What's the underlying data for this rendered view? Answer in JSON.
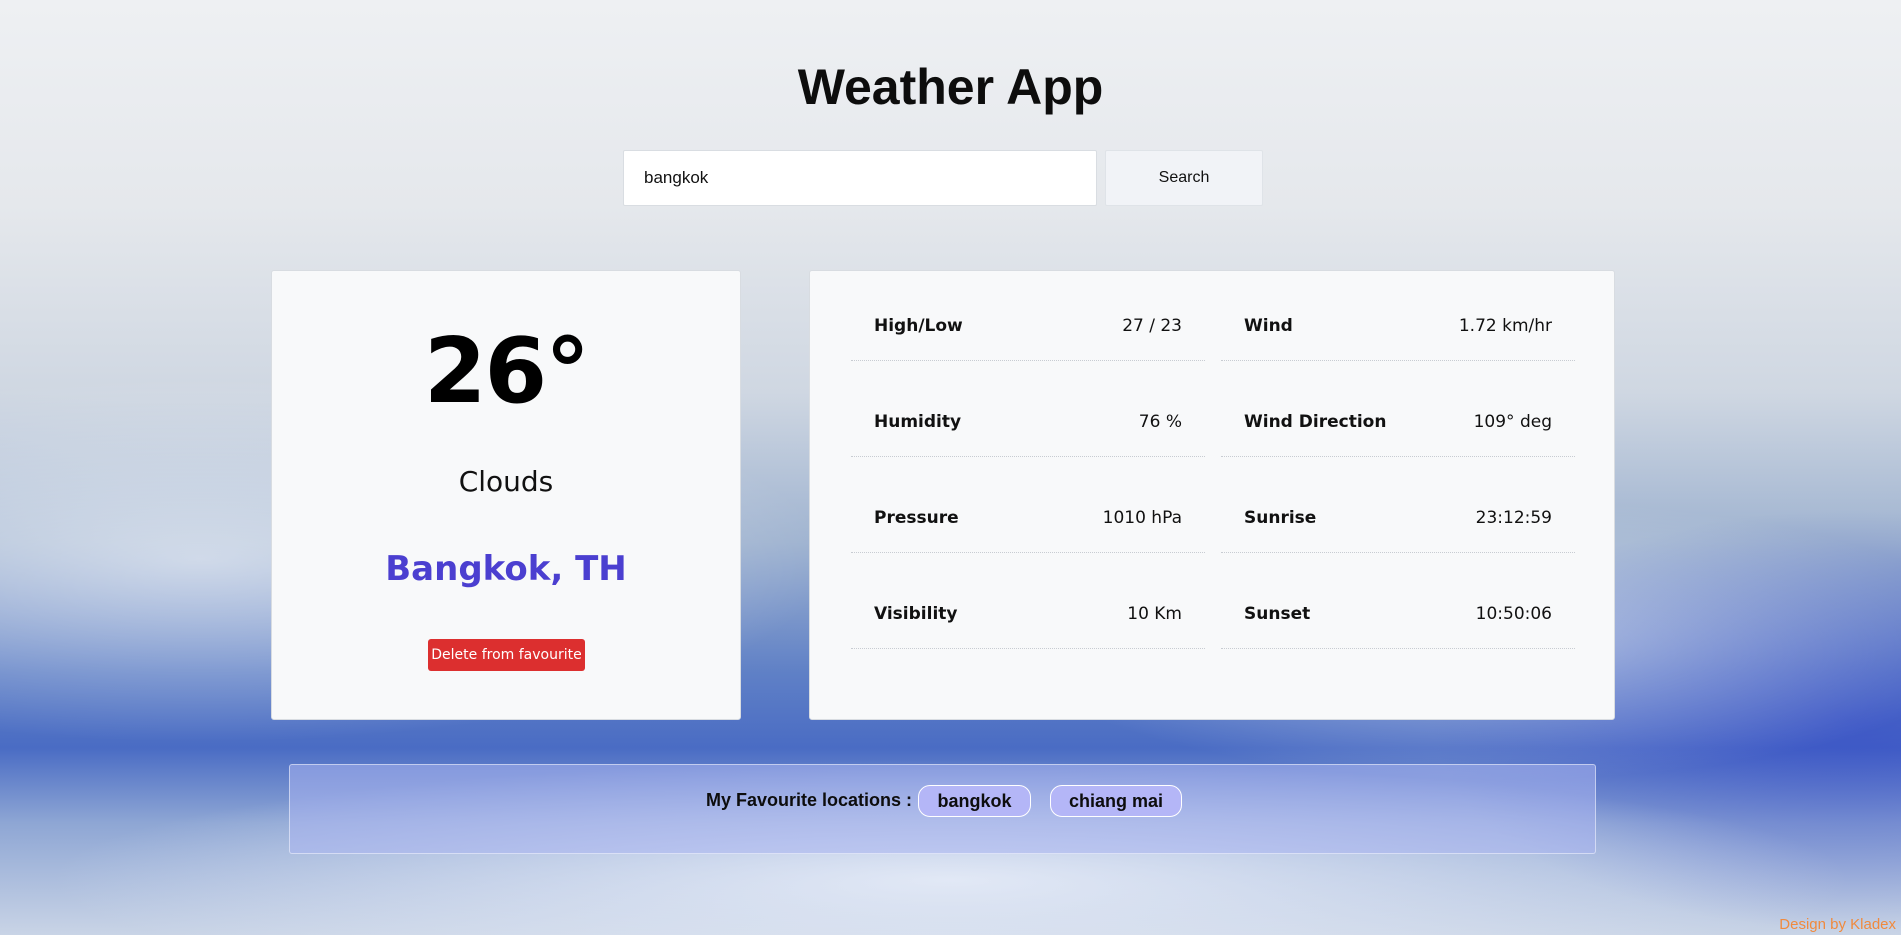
{
  "app": {
    "title": "Weather App"
  },
  "search": {
    "value": "bangkok",
    "button_label": "Search"
  },
  "current": {
    "temperature": "26°",
    "condition": "Clouds",
    "location": "Bangkok, TH",
    "delete_label": "Delete from favourite"
  },
  "details": [
    {
      "label": "High/Low",
      "value": "27 / 23"
    },
    {
      "label": "Wind",
      "value": "1.72 km/hr"
    },
    {
      "label": "Humidity",
      "value": "76 %"
    },
    {
      "label": "Wind Direction",
      "value": "109° deg"
    },
    {
      "label": "Pressure",
      "value": "1010 hPa"
    },
    {
      "label": "Sunrise",
      "value": "23:12:59"
    },
    {
      "label": "Visibility",
      "value": "10 Km"
    },
    {
      "label": "Sunset",
      "value": "10:50:06"
    }
  ],
  "favourites": {
    "label": "My Favourite locations :",
    "items": [
      "bangkok",
      "chiang mai"
    ]
  },
  "footer": {
    "credit": "Design by Kladex"
  },
  "colors": {
    "accent_city": "#4b3fd0",
    "delete_button": "#dc2f2f",
    "chip": "#b4b6f7",
    "credit": "#f08a3e"
  }
}
